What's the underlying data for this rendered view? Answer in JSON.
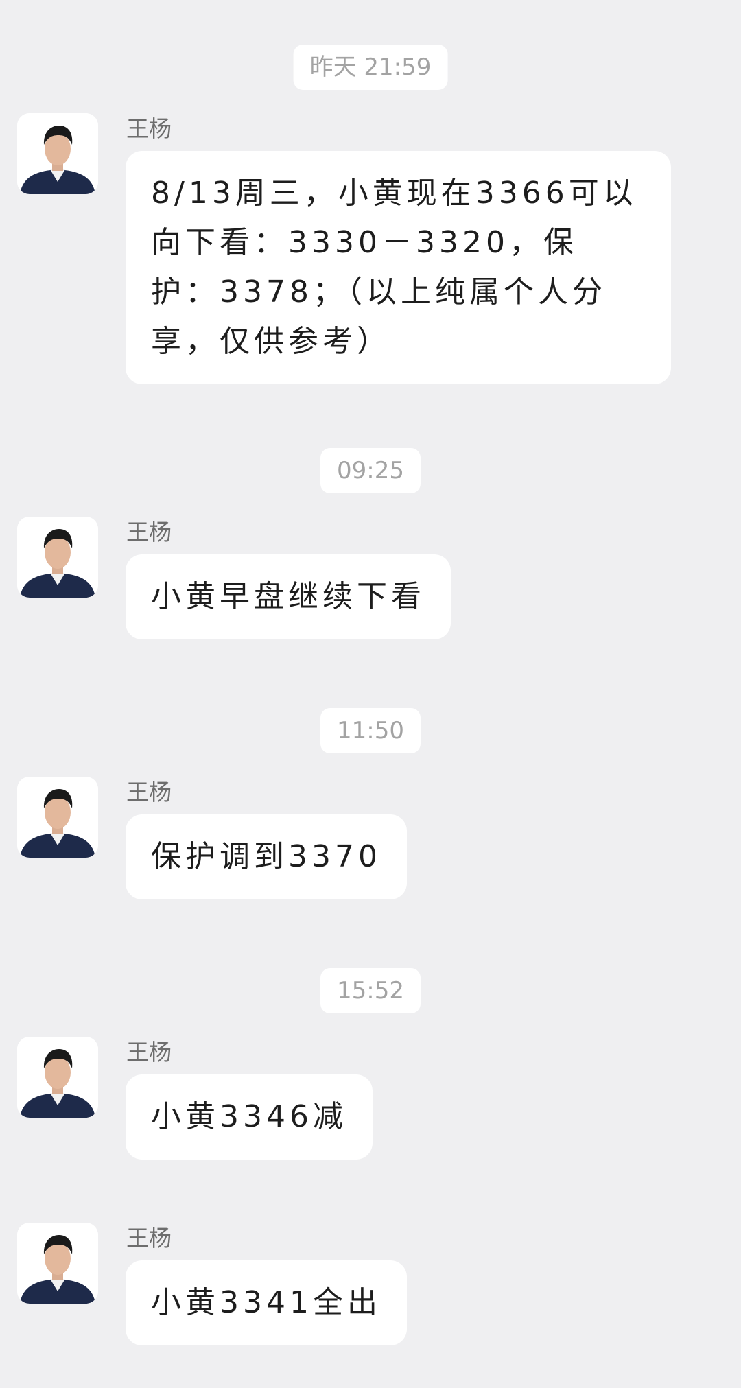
{
  "chat": {
    "messages": [
      {
        "timestamp": "昨天 21:59",
        "sender": "王杨",
        "text": "8/13周三，小黄现在3366可以向下看：3330－3320，保护：3378；（以上纯属个人分享，仅供参考）"
      },
      {
        "timestamp": "09:25",
        "sender": "王杨",
        "text": "小黄早盘继续下看"
      },
      {
        "timestamp": "11:50",
        "sender": "王杨",
        "text": "保护调到3370"
      },
      {
        "timestamp": "15:52",
        "sender": "王杨",
        "text": "小黄3346减"
      },
      {
        "sender": "王杨",
        "text": "小黄3341全出"
      }
    ]
  },
  "colors": {
    "background": "#efeff1",
    "bubble": "#ffffff",
    "timestamp_text": "#a3a3a3",
    "sender_text": "#6d6d6d",
    "message_text": "#1d1d1d",
    "suit": "#1e2a4a"
  },
  "icons": {
    "avatar": "profile-photo-avatar"
  }
}
